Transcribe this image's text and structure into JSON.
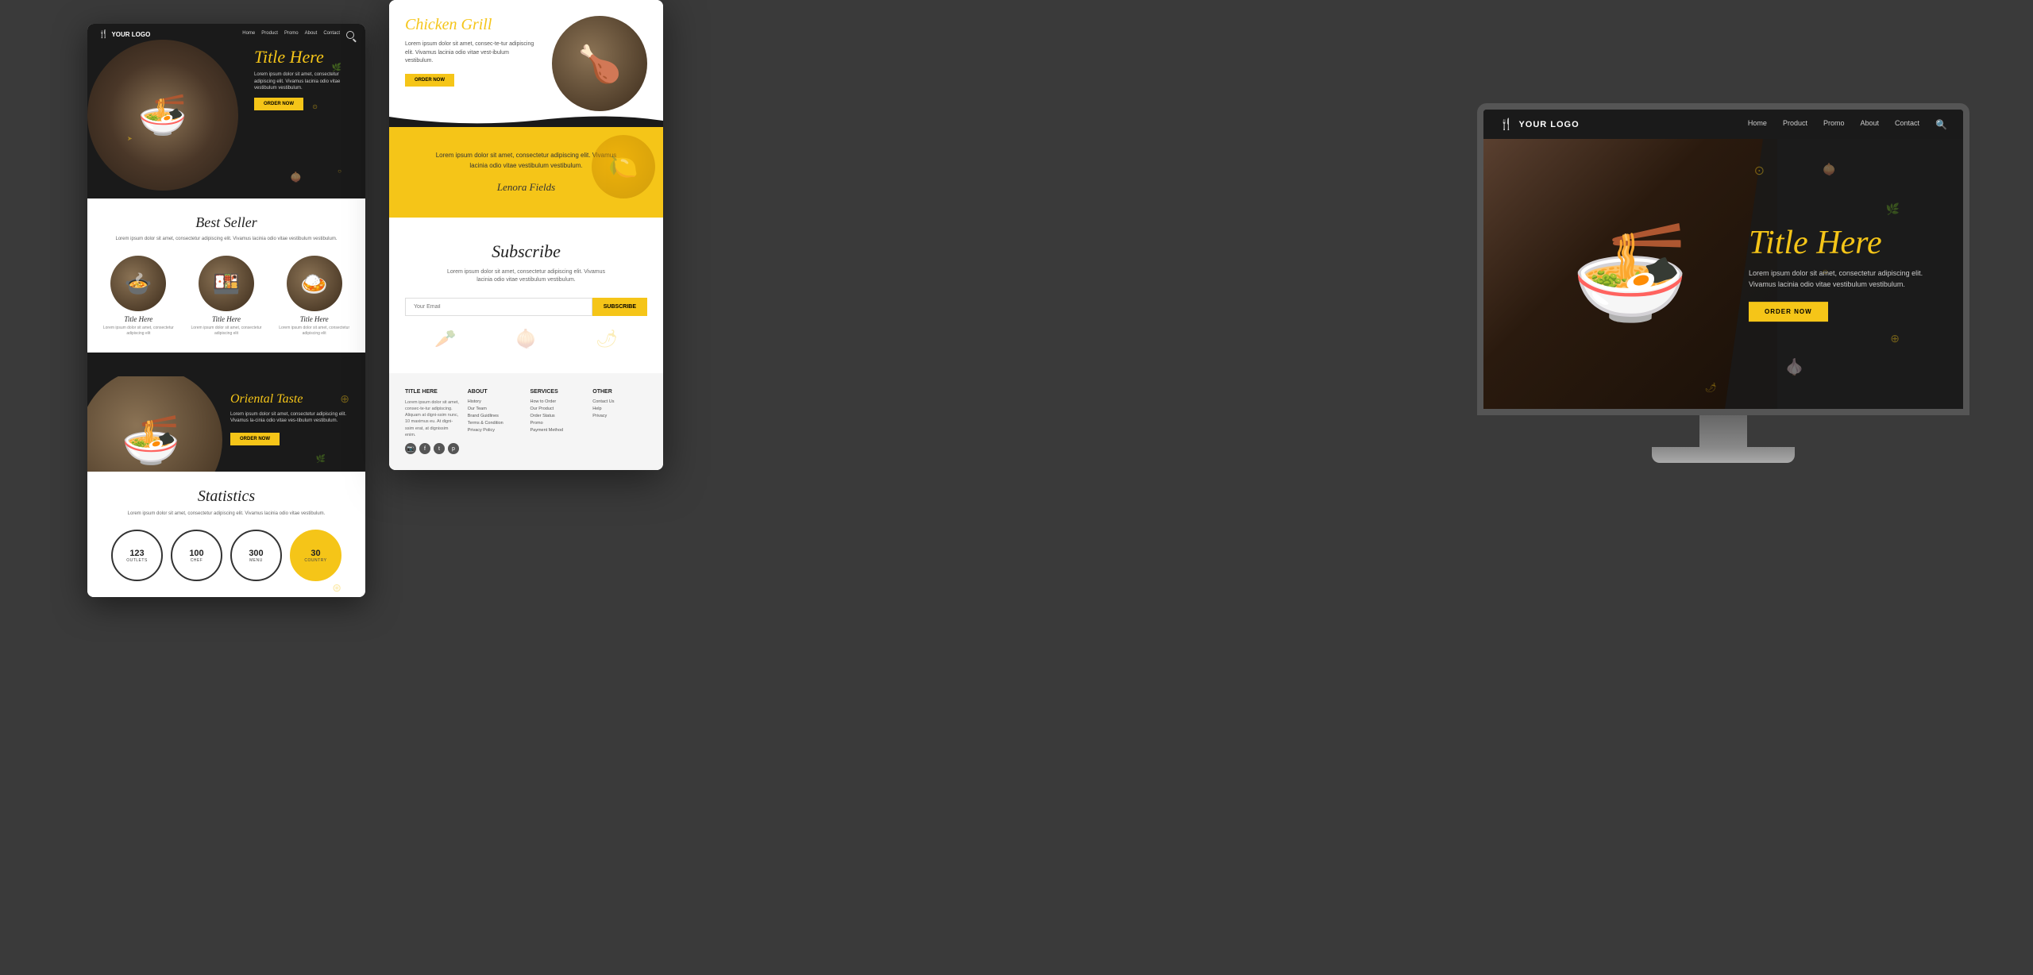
{
  "bg_color": "#3a3a3a",
  "left_mockup": {
    "nav": {
      "logo": "YOUR LOGO",
      "links": [
        "Home",
        "Product",
        "Promo",
        "About",
        "Contact"
      ]
    },
    "hero": {
      "title": "Title Here",
      "description": "Lorem ipsum dolor sit amet, consectetur adipiscing elit. Vivamus lacinia odio vitae vestibulum vestibulum.",
      "cta": "ORDER NOW"
    },
    "bestseller": {
      "title": "Best Seller",
      "description": "Lorem ipsum dolor sit amet, consectetur adipiscing elit. Vivamus lacinia odio vitae vestibulum vestibulum.",
      "products": [
        {
          "name": "Title Here",
          "desc": "Lorem ipsum dolor sit amet, consectetur adipiscing elit"
        },
        {
          "name": "Title Here",
          "desc": "Lorem ipsum dolor sit amet, consectetur adipiscing elit"
        },
        {
          "name": "Title Here",
          "desc": "Lorem ipsum dolor sit amet, consectetur adipiscing elit"
        }
      ]
    },
    "oriental": {
      "title": "Oriental Taste",
      "description": "Lorem ipsum dolor sit amet, consectetur adipiscing elit. Vivamus la-cinia odio vitae ves-tibulum vestibulum.",
      "cta": "ORDER NOW"
    },
    "statistics": {
      "title": "Statistics",
      "description": "Lorem ipsum dolor sit amet, consectetur adipiscing elit. Vivamus lacinia odio vitae vestibulum.",
      "stats": [
        {
          "num": "123",
          "label": "OUTLETS"
        },
        {
          "num": "100",
          "label": "CHEF"
        },
        {
          "num": "300",
          "label": "MENU"
        },
        {
          "num": "30",
          "label": "COUNTRY",
          "highlight": true
        }
      ]
    }
  },
  "mid_mockup": {
    "hero": {
      "title": "Chicken Grill",
      "description": "Lorem ipsum dolor sit amet, consec-te-tur adipiscing elit. Vivamus lacinia odio vitae vest-ibulum vestibulum.",
      "cta": "ORDER NOW"
    },
    "testimonial": {
      "text": "Lorem ipsum dolor sit amet, consectetur adipiscing elit. Vivamus lacinia odio vitae vestibulum vestibulum.",
      "author": "Lenora Fields"
    },
    "subscribe": {
      "title": "Subscribe",
      "description": "Lorem ipsum dolor sit amet, consectetur adipiscing elit. Vivamus lacinia odio vitae vestibulum vestibulum.",
      "email_placeholder": "Your Email",
      "cta": "SUBSCRIBE"
    },
    "footer": {
      "col1": {
        "title": "TITLE HERE",
        "desc": "Lorem ipsum dolor sit amet, consec-te-tur adipiscing. Aliquam at digni-ssim nunc, 10 maximus eu. At digni-ssim erat, at dignissim enim."
      },
      "col2": {
        "title": "ABOUT",
        "links": [
          "History",
          "Our Team",
          "Brand Guidlines",
          "Terms & Condition",
          "Privacy Policy"
        ]
      },
      "col3": {
        "title": "SERVICES",
        "links": [
          "How to Order",
          "Our Product",
          "Order Status",
          "Promo",
          "Payment Method"
        ]
      },
      "col4": {
        "title": "OTHER",
        "links": [
          "Contact Us",
          "Help",
          "Privacy"
        ]
      }
    }
  },
  "right_mockup": {
    "nav": {
      "logo": "YOUR LOGO",
      "links": [
        "Home",
        "Product",
        "Promo",
        "About",
        "Contact"
      ]
    },
    "hero": {
      "title": "Title Here",
      "description": "Lorem ipsum dolor sit amet, consectetur adipiscing elit. Vivamus lacinia odio vitae vestibulum vestibulum.",
      "cta": "ORDER NOW"
    }
  }
}
